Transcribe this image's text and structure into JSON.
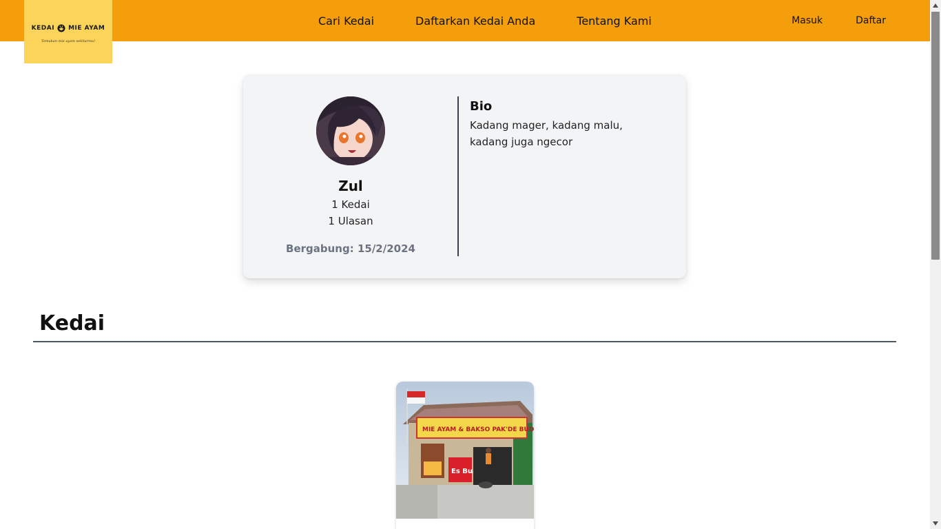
{
  "brand": {
    "name": "KEDAI",
    "name2": "MIE AYAM",
    "tagline": "Temukan mie ayam sekitarmu!"
  },
  "nav": {
    "main": [
      "Cari Kedai",
      "Daftarkan Kedai Anda",
      "Tentang Kami"
    ],
    "login": "Masuk",
    "register": "Daftar"
  },
  "profile": {
    "name": "Zul",
    "kedai_count": "1 Kedai",
    "ulasan_count": "1 Ulasan",
    "joined": "Bergabung: 15/2/2024",
    "bio_title": "Bio",
    "bio_text": "Kadang mager, kadang malu, kadang juga ngecor"
  },
  "kedai_section": {
    "title": "Kedai",
    "shop_sign": "MIE AYAM & BAKSO PAK'DE BUDENG",
    "banner": "Es Buah"
  },
  "colors": {
    "accent": "#f59e0b",
    "logo_bg": "#fdd45a",
    "card_bg": "#f3f4f6"
  }
}
